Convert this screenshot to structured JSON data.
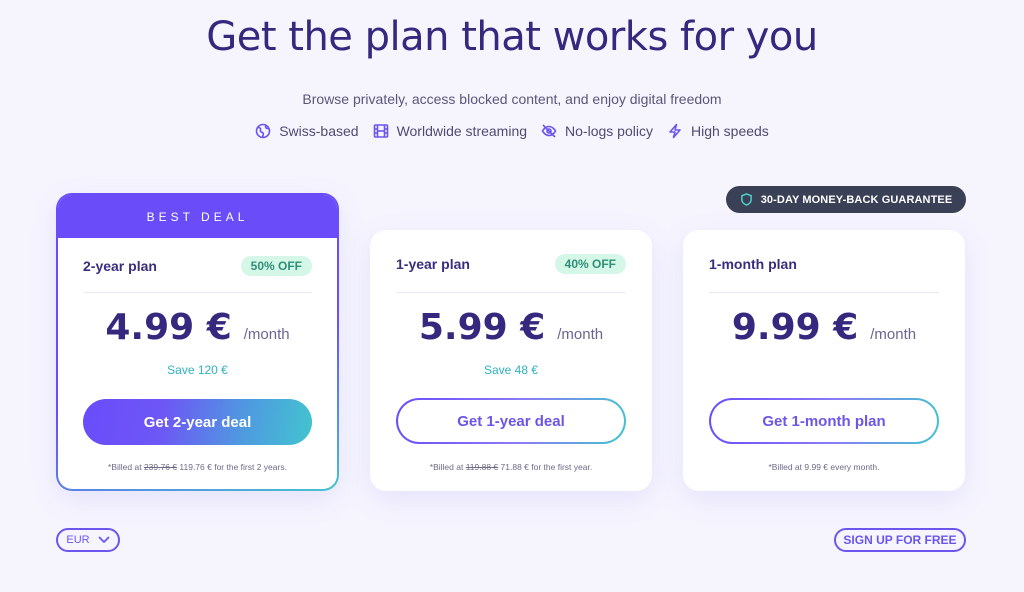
{
  "header": {
    "title": "Get the plan that works for you",
    "subtitle": "Browse privately, access blocked content, and enjoy digital freedom"
  },
  "features": [
    {
      "icon": "globe-icon",
      "label": "Swiss-based"
    },
    {
      "icon": "film-icon",
      "label": "Worldwide streaming"
    },
    {
      "icon": "eye-off-icon",
      "label": "No-logs policy"
    },
    {
      "icon": "lightning-icon",
      "label": "High speeds"
    }
  ],
  "guarantee": {
    "icon": "shield-icon",
    "label": "30-DAY MONEY-BACK GUARANTEE"
  },
  "plans": [
    {
      "badge": "BEST DEAL",
      "name": "2-year plan",
      "discount": "50% OFF",
      "price": "4.99 €",
      "period": "/month",
      "save": "Save 120 €",
      "cta": "Get 2-year deal",
      "billed_prefix": "*Billed at ",
      "billed_old": "239.76 €",
      "billed_suffix": " 119.76 € for the first 2 years."
    },
    {
      "name": "1-year plan",
      "discount": "40% OFF",
      "price": "5.99 €",
      "period": "/month",
      "save": "Save 48 €",
      "cta": "Get 1-year deal",
      "billed_prefix": "*Billed at ",
      "billed_old": "119.88 €",
      "billed_suffix": " 71.88 € for the first year."
    },
    {
      "name": "1-month plan",
      "price": "9.99 €",
      "period": "/month",
      "cta": "Get 1-month plan",
      "billed": "*Billed at 9.99 € every month."
    }
  ],
  "footer": {
    "currency": "EUR",
    "signup": "SIGN UP FOR FREE"
  },
  "colors": {
    "accent": "#6b4cf9",
    "teal": "#43c4cf",
    "title": "#35287e",
    "discount_bg": "#d5f7e8",
    "guarantee_bg": "#3a4055"
  }
}
